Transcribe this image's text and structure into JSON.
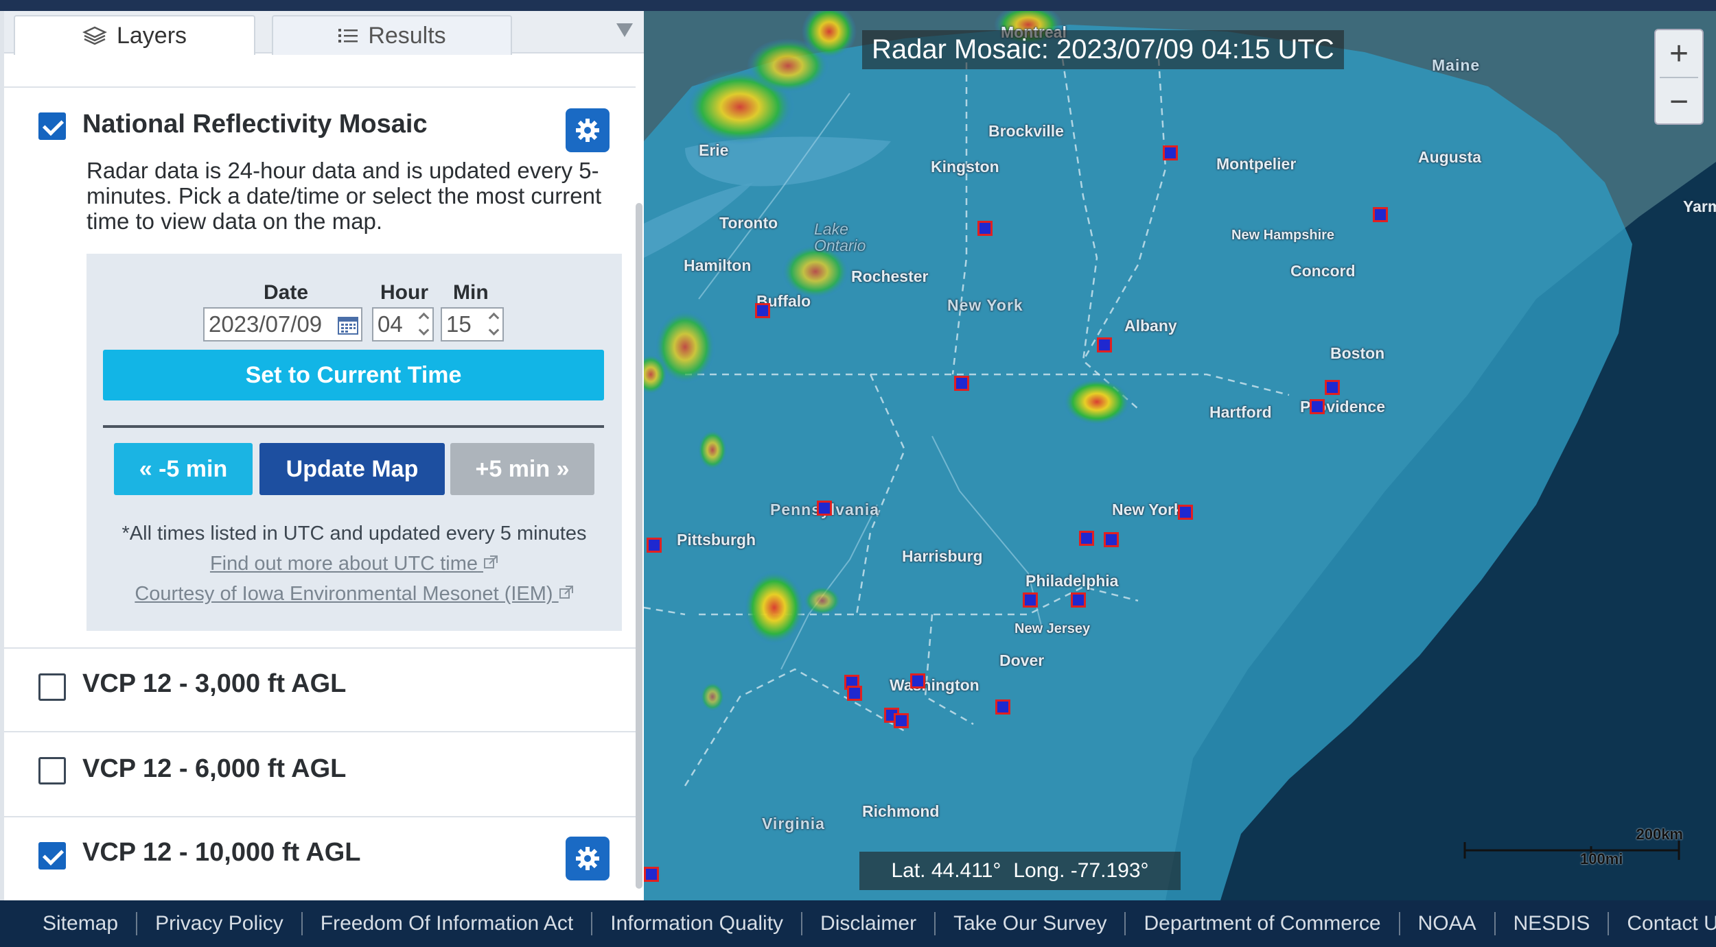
{
  "tabs": {
    "layers": "Layers",
    "results": "Results"
  },
  "layers": [
    {
      "title": "National Reflectivity Mosaic",
      "checked": true
    },
    {
      "title": "VCP 12 - 3,000 ft AGL",
      "checked": false
    },
    {
      "title": "VCP 12 - 6,000 ft AGL",
      "checked": false
    },
    {
      "title": "VCP 12 - 10,000 ft AGL",
      "checked": true
    }
  ],
  "mosaic": {
    "description": "Radar data is 24-hour data and is updated every 5-minutes. Pick a date/time or select the most current time to view data on the map.",
    "date_label": "Date",
    "hour_label": "Hour",
    "min_label": "Min",
    "date_value": "2023/07/09",
    "hour_value": "04",
    "min_value": "15",
    "set_current_label": "Set to Current Time",
    "minus_label": "« -5 min",
    "update_label": "Update Map",
    "plus_label": "+5 min »",
    "note": "*All times listed in UTC and updated every 5 minutes",
    "link_utc": "Find out more about UTC time",
    "link_iem": "Courtesy of Iowa Environmental Mesonet (IEM)"
  },
  "map": {
    "title": "Radar Mosaic: 2023/07/09 04:15 UTC",
    "zoom_in": "+",
    "zoom_out": "−",
    "lat_text": "Lat. 44.411°",
    "long_text": "Long. -77.193°",
    "scale_km": "200km",
    "scale_mi": "100mi",
    "cities": [
      "Brockville",
      "Kingston",
      "Montpelier",
      "Augusta",
      "Toronto",
      "Hamilton",
      "Rochester",
      "Buffalo",
      "Concord",
      "Albany",
      "Boston",
      "Hartford",
      "Providence",
      "New York",
      "Pittsburgh",
      "Harrisburg",
      "Philadelphia",
      "Dover",
      "Washington",
      "Richmond",
      "Maine",
      "New Hampshire",
      "New York",
      "Pennsylvania",
      "New Jersey",
      "Virginia",
      "Lake Ontario",
      "Erie",
      "Montreal",
      "Yarm"
    ]
  },
  "footer": [
    "Sitemap",
    "Privacy Policy",
    "Freedom Of Information Act",
    "Information Quality",
    "Disclaimer",
    "Take Our Survey",
    "Department of Commerce",
    "NOAA",
    "NESDIS",
    "Contact Us"
  ],
  "colors": {
    "accent": "#1a6ac4",
    "cyan_button": "#12b5e6",
    "update_button": "#1d4fa0",
    "footer_bg": "#0f2a4a",
    "site_fill": "#1f28d0",
    "site_border": "#e12020"
  },
  "icons": {
    "layers_tab": "layers-icon",
    "results_tab": "list-icon",
    "settings": "gear-icon",
    "calendar": "calendar-icon",
    "external_link": "external-link-icon"
  }
}
